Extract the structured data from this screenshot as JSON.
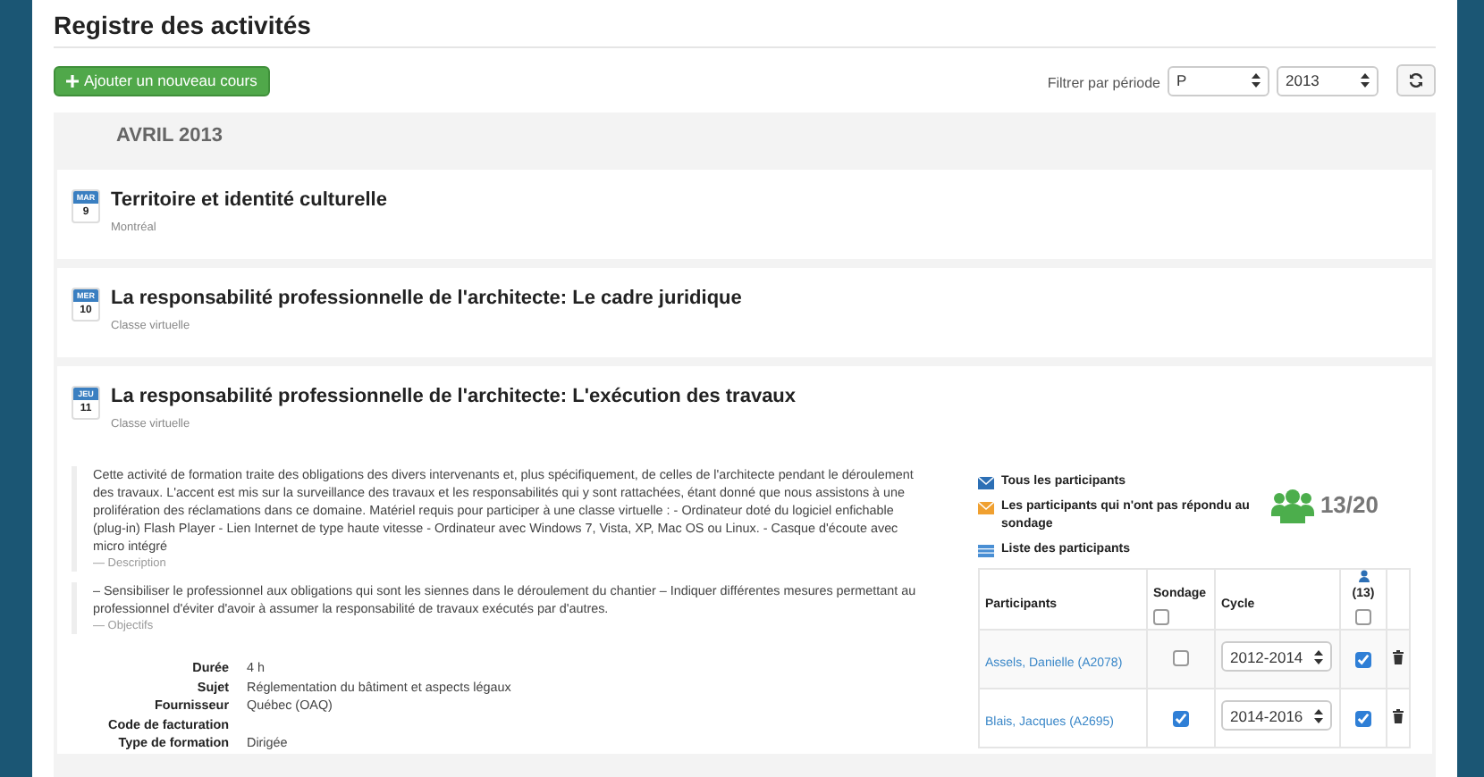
{
  "title": "Registre des activités",
  "add_button": {
    "label": "Ajouter un nouveau cours"
  },
  "filter": {
    "label": "Filtrer par période",
    "period": "P",
    "year": "2013"
  },
  "month": "AVRIL 2013",
  "courses": [
    {
      "day_abbr": "MAR",
      "day_num": "9",
      "title": "Territoire et identité culturelle",
      "subtitle": "Montréal"
    },
    {
      "day_abbr": "MER",
      "day_num": "10",
      "title": "La responsabilité professionnelle de l'architecte: Le cadre juridique",
      "subtitle": "Classe virtuelle"
    },
    {
      "day_abbr": "JEU",
      "day_num": "11",
      "title": "La responsabilité professionnelle de l'architecte: L'exécution des travaux",
      "subtitle": "Classe virtuelle",
      "details": {
        "quotes": [
          {
            "text": "Cette activité de formation traite des obligations des divers intervenants et, plus spécifiquement, de celles de l'architecte pendant le déroulement des travaux. L'accent est mis sur la surveillance des travaux et les responsabilités qui y sont rattachées, étant donné que nous assistons à une prolifération des réclamations dans ce domaine. Matériel requis pour participer à une classe virtuelle : - Ordinateur doté du logiciel enfichable (plug-in) Flash Player - Lien Internet de type haute vitesse - Ordinateur avec Windows 7, Vista, XP, Mac OS ou Linux. - Casque d'écoute avec micro intégré",
            "source": "— Description"
          },
          {
            "text": "– Sensibiliser le professionnel aux obligations qui sont les siennes dans le déroulement du chantier – Indiquer différentes mesures permettant au professionnel d'éviter d'avoir à assumer la responsabilité de travaux exécutés par d'autres.",
            "source": "— Objectifs"
          }
        ],
        "fields": [
          {
            "label": "Durée",
            "value": "4 h"
          },
          {
            "label": "Sujet",
            "value": "Réglementation du bâtiment et aspects légaux"
          },
          {
            "label": "Fournisseur",
            "value": "Québec (OAQ)"
          },
          {
            "label": "Code de facturation"
          },
          {
            "label": "Type de formation",
            "value": "Dirigée"
          }
        ],
        "links": [
          {
            "kind": "email",
            "label": "Tous les participants"
          },
          {
            "kind": "email-warning",
            "label": "Les participants qui n'ont pas répondu au sondage"
          },
          {
            "kind": "list",
            "label": "Liste des participants"
          }
        ],
        "count": "13/20",
        "table": {
          "col_participants": "Participants",
          "col_survey": "Sondage",
          "survey_all_checked": false,
          "col_cycle": "Cycle",
          "col_present_count": "(13)",
          "present_all_checked": false,
          "rows": [
            {
              "name": "Assels, Danielle (A2078)",
              "survey": false,
              "cycle": "2012-2014",
              "present": true
            },
            {
              "name": "Blais, Jacques (A2695)",
              "survey": true,
              "cycle": "2014-2016",
              "present": true
            }
          ]
        }
      }
    }
  ]
}
